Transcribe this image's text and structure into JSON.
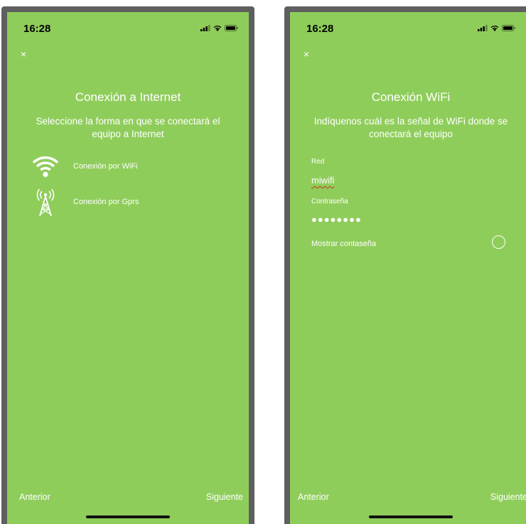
{
  "status_bar": {
    "time": "16:28"
  },
  "screen_internet": {
    "close": "×",
    "title": "Conexión a Internet",
    "subtitle": "Seleccione la forma en que se conectará el equipo a Internet",
    "options": [
      {
        "label": "Conexión por WiFi",
        "icon": "wifi-icon"
      },
      {
        "label": "Conexión por Gprs",
        "icon": "antenna-tower-icon"
      }
    ],
    "prev": "Anterior",
    "next": "Siguiente"
  },
  "screen_wifi": {
    "close": "×",
    "title": "Conexión WiFi",
    "subtitle": "Indíquenos cuál es la señal de WiFi donde se conectará el equipo",
    "network_label": "Red",
    "network_value": "miwifi",
    "password_label": "Contraseña",
    "password_value": "●●●●●●●●",
    "show_password_label": "Mostrar contaseña",
    "show_password_checked": false,
    "prev": "Anterior",
    "next": "Siguiente"
  },
  "colors": {
    "screen_background": "#8fcd5b",
    "frame": "#5f5f5f",
    "text": "#ffffff"
  }
}
